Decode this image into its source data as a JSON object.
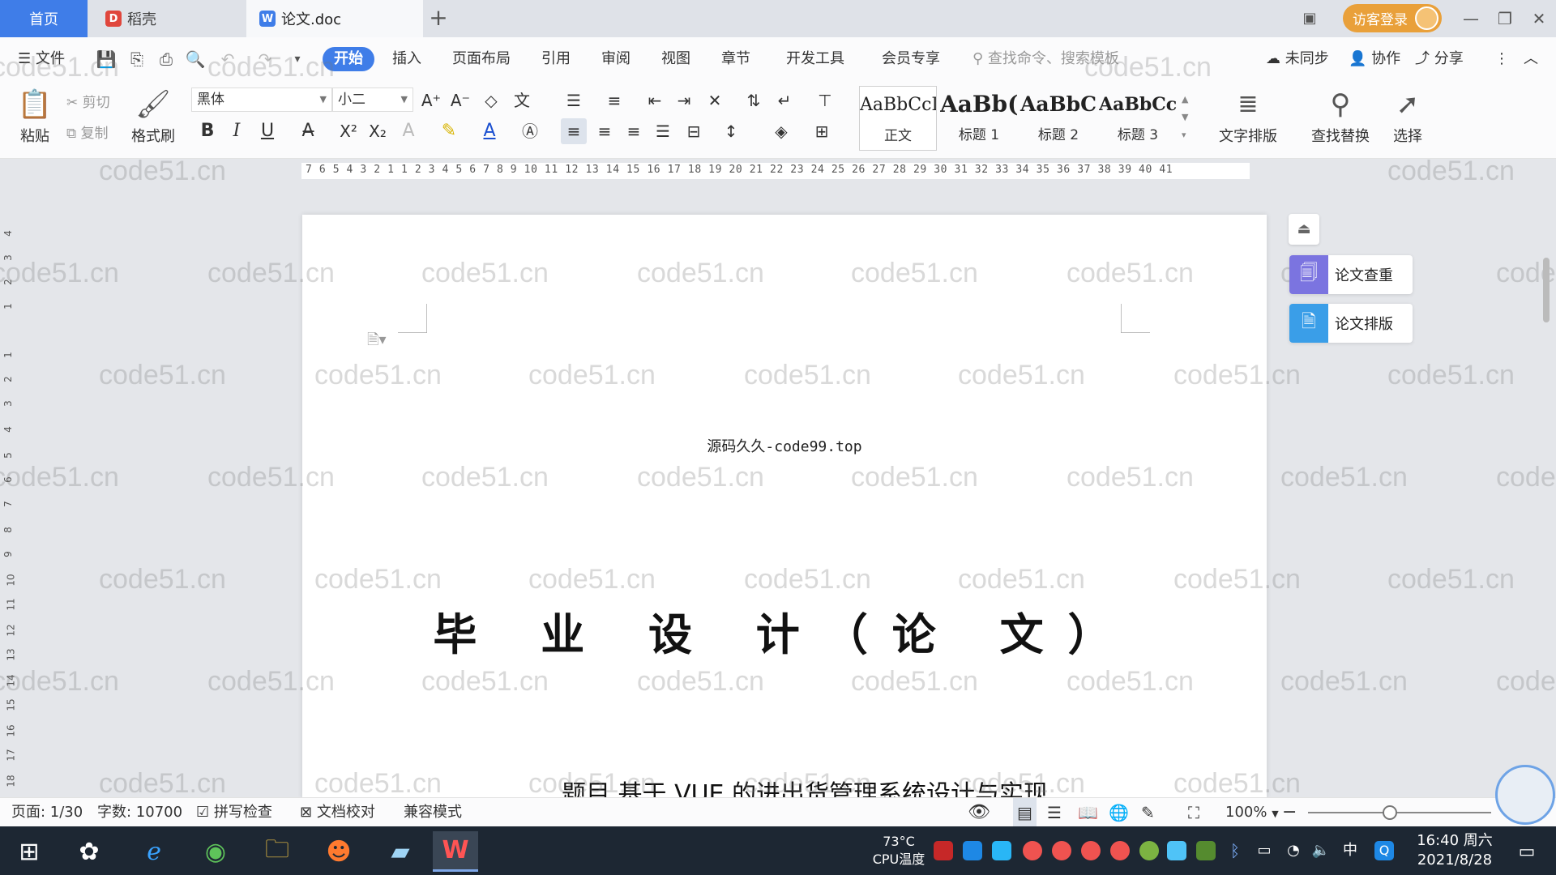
{
  "tabs": {
    "home": "首页",
    "docer": "稻壳",
    "doc": "论文.doc",
    "add": "+"
  },
  "guest_login": "访客登录",
  "window_controls": {
    "minimize": "—",
    "restore": "❐",
    "close": "✕"
  },
  "menu": {
    "file": "文件",
    "items": [
      "开始",
      "插入",
      "页面布局",
      "引用",
      "审阅",
      "视图",
      "章节",
      "开发工具",
      "会员专享"
    ],
    "active": "开始",
    "search_placeholder": "查找命令、搜索模板",
    "right": {
      "sync": "未同步",
      "collab": "协作",
      "share": "分享"
    }
  },
  "ribbon": {
    "paste": "粘贴",
    "cut": "剪切",
    "copy": "复制",
    "format_painter": "格式刷",
    "font_name": "黑体",
    "font_size": "小二",
    "styles": [
      {
        "preview": "AaBbCcI",
        "name": "正文"
      },
      {
        "preview": "AaBb(",
        "name": "标题 1"
      },
      {
        "preview": "AaBbC",
        "name": "标题 2"
      },
      {
        "preview": "AaBbCcl",
        "name": "标题 3"
      }
    ],
    "text_layout": "文字排版",
    "find_replace": "查找替换",
    "select": "选择"
  },
  "ruler_numbers": "7  6  5  4  3  2  1     1  2  3  4  5  6  7  8  9  10 11 12 13 14 15 16 17 18 19 20 21 22 23 24 25 26 27 28 29 30 31 32 33 34 35 36 37 38 39 40 41",
  "vruler_numbers": [
    "4",
    "3",
    "2",
    "1",
    "1",
    "2",
    "3",
    "4",
    "5",
    "6",
    "7",
    "8",
    "9",
    "10",
    "11",
    "12",
    "13",
    "14",
    "15",
    "16",
    "17",
    "18"
  ],
  "document": {
    "header_line": "源码久久-code99.top",
    "title": "毕 业 设 计（论 文）",
    "topic": "题目  基于 VUE 的进出货管理系统设计与实现"
  },
  "side_panel": {
    "check": "论文查重",
    "layout": "论文排版"
  },
  "watermark": "code51.cn",
  "status": {
    "page": "页面: 1/30",
    "words": "字数: 10700",
    "spell": "拼写检查",
    "proof": "文档校对",
    "compat": "兼容模式",
    "zoom": "100%"
  },
  "taskbar": {
    "cpu_temp": "73°C",
    "cpu_label": "CPU温度",
    "ime": "中",
    "time": "16:40 周六",
    "date": "2021/8/28"
  },
  "colors": {
    "accent": "#3f7de8",
    "guest": "#e9a03a",
    "wps_red": "#d93a32",
    "taskbar": "#1d2733"
  }
}
